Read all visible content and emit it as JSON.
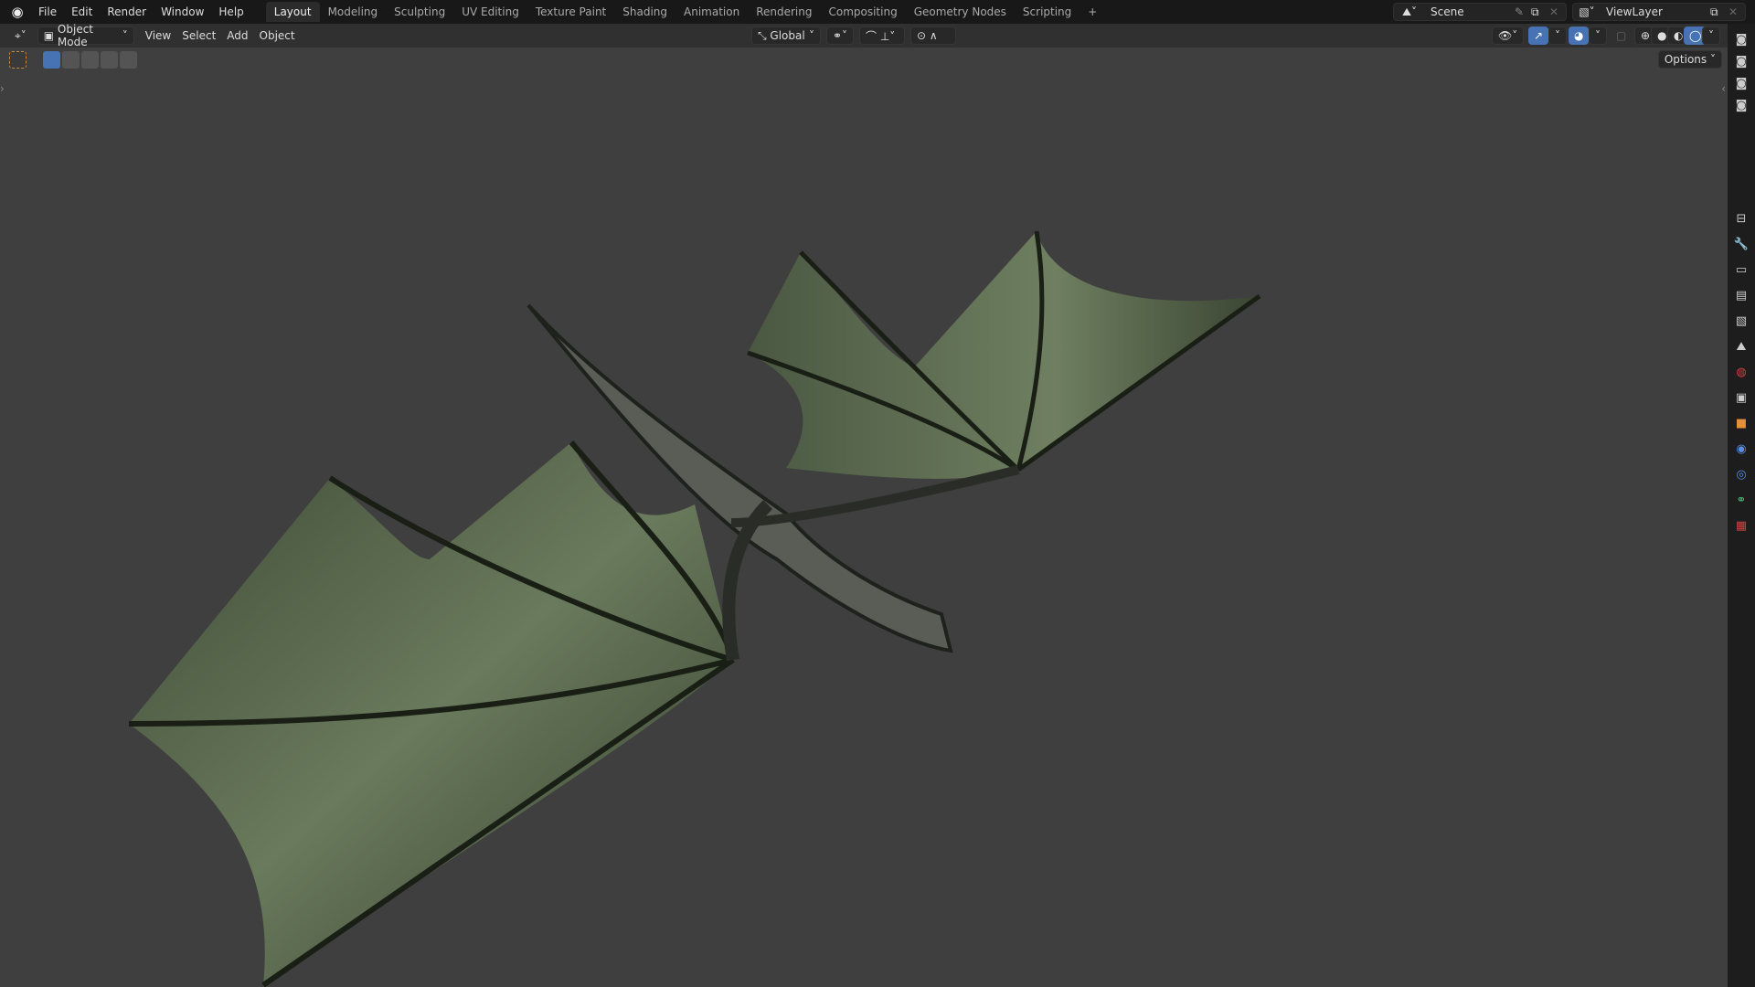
{
  "menu": [
    "File",
    "Edit",
    "Render",
    "Window",
    "Help"
  ],
  "workspaces": [
    "Layout",
    "Modeling",
    "Sculpting",
    "UV Editing",
    "Texture Paint",
    "Shading",
    "Animation",
    "Rendering",
    "Compositing",
    "Geometry Nodes",
    "Scripting"
  ],
  "add_workspace": "+",
  "scene": "Scene",
  "view_layer": "ViewLayer",
  "header": {
    "mode": "Object Mode",
    "view": "View",
    "select": "Select",
    "add": "Add",
    "object": "Object",
    "orientation": "Global"
  },
  "options": "Options",
  "colors": {
    "accent": "#4772b3",
    "viewport": "#3f3f3f",
    "wing": "#5f6d52"
  }
}
